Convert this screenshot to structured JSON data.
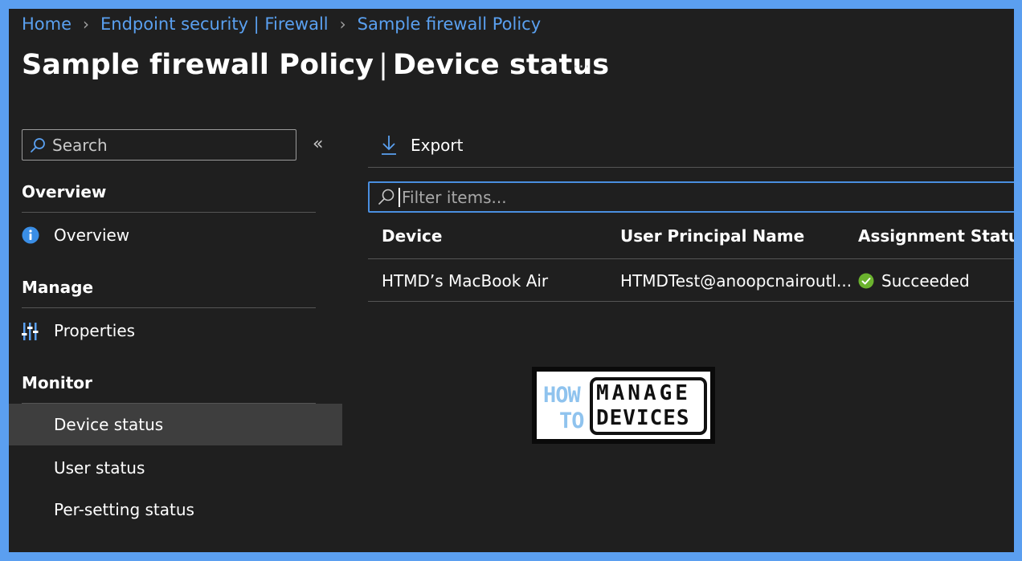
{
  "breadcrumb": {
    "items": [
      "Home",
      "Endpoint security | Firewall",
      "Sample firewall Policy"
    ]
  },
  "header": {
    "title_main": "Sample firewall Policy",
    "title_separator": "|",
    "title_sub": "Device status",
    "more_label": "···"
  },
  "sidebar": {
    "search_placeholder": "Search",
    "collapse_label": "«",
    "sections": {
      "overview": "Overview",
      "manage": "Manage",
      "monitor": "Monitor"
    },
    "items": {
      "overview": "Overview",
      "properties": "Properties",
      "device_status": "Device status",
      "user_status": "User status",
      "per_setting_status": "Per-setting status"
    },
    "active_item": "device_status"
  },
  "toolbar": {
    "export_label": "Export"
  },
  "filter": {
    "placeholder": "Filter items..."
  },
  "table": {
    "columns": [
      "Device",
      "User Principal Name",
      "Assignment Status"
    ],
    "rows": [
      {
        "device": "HTMD’s MacBook Air",
        "upn": "HTMDTest@anoopcnairoutl...",
        "status": "Succeeded"
      }
    ]
  },
  "logo": {
    "line1_left": "HOW",
    "line2_left": "TO",
    "line1_right": "MANAGE",
    "line2_right": "DEVICES"
  },
  "colors": {
    "background": "#1f1f1f",
    "frame": "#5b9ff0",
    "link": "#5aa0f0",
    "active_item": "#3e3e3e",
    "success": "#6bb32e",
    "info": "#3a8ee6"
  }
}
